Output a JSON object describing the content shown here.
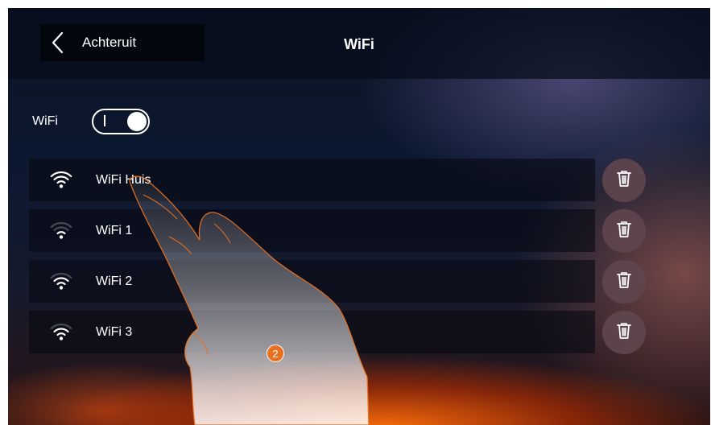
{
  "header": {
    "back_label": "Achteruit",
    "title": "WiFi"
  },
  "wifi_toggle": {
    "label": "WiFi",
    "state": "on"
  },
  "networks": [
    {
      "name": "WiFi Huis",
      "signal": "strong"
    },
    {
      "name": "WiFi 1",
      "signal": "weak"
    },
    {
      "name": "WiFi 2",
      "signal": "medium"
    },
    {
      "name": "WiFi 3",
      "signal": "medium"
    }
  ],
  "step_badge": "2",
  "icons": {
    "back": "chevron-left-icon",
    "wifi": "wifi-icon",
    "delete": "trash-icon"
  },
  "colors": {
    "badge": "#e8701e",
    "delete_button": "#5f464e",
    "row_background": "#080a14"
  }
}
